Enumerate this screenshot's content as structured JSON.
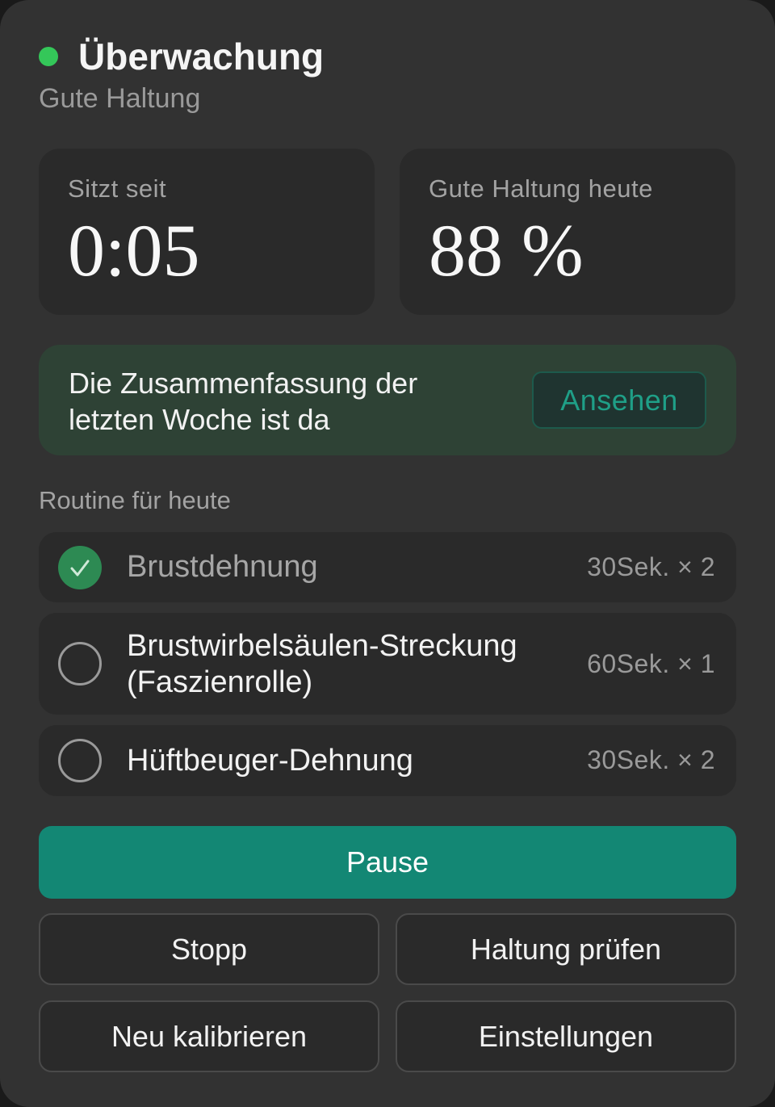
{
  "header": {
    "title": "Überwachung",
    "status": "Gute Haltung",
    "status_color": "#34c759"
  },
  "stats": [
    {
      "label": "Sitzt seit",
      "value": "0:05"
    },
    {
      "label": "Gute Haltung heute",
      "value": "88 %"
    }
  ],
  "summary": {
    "text_line1": "Die Zusammenfassung der",
    "text_line2": "letzten Woche ist da",
    "button_label": "Ansehen"
  },
  "routine": {
    "heading": "Routine für heute",
    "items": [
      {
        "name": "Brustdehnung",
        "duration": "30Sek. × 2",
        "done": true
      },
      {
        "name_line1": "Brustwirbelsäulen-Streckung",
        "name_line2": "(Faszienrolle)",
        "duration": "60Sek. × 1",
        "done": false
      },
      {
        "name": "Hüftbeuger-Dehnung",
        "duration": "30Sek. × 2",
        "done": false
      }
    ]
  },
  "actions": {
    "pause": "Pause",
    "stop": "Stopp",
    "check_posture": "Haltung prüfen",
    "recalibrate": "Neu kalibrieren",
    "settings": "Einstellungen"
  },
  "colors": {
    "accent": "#138774",
    "panel": "#323232",
    "card": "#2a2a2a",
    "success": "#2d8a53"
  }
}
